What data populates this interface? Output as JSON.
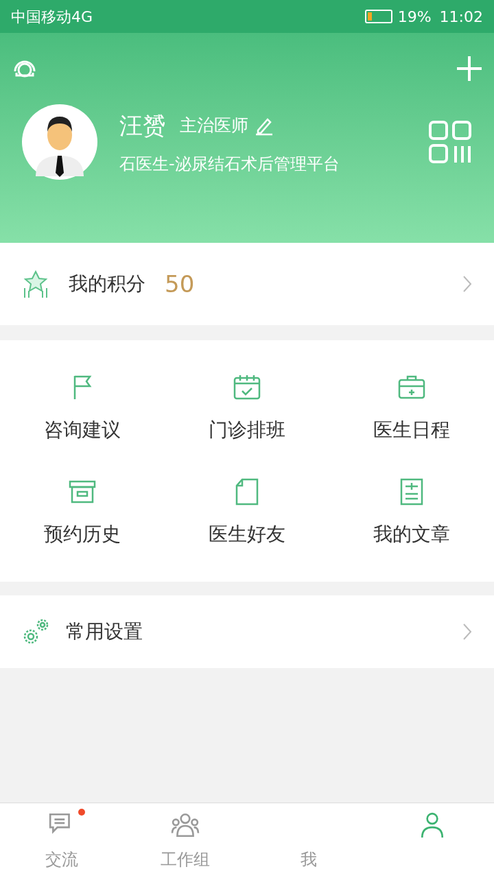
{
  "status_bar": {
    "carrier": "中国移动4G",
    "battery": "19%",
    "time": "11:02"
  },
  "profile": {
    "name": "汪赟",
    "title": "主治医师",
    "platform": "石医生-泌尿结石术后管理平台"
  },
  "points": {
    "label": "我的积分",
    "value": "50"
  },
  "grid": [
    {
      "label": "咨询建议"
    },
    {
      "label": "门诊排班"
    },
    {
      "label": "医生日程"
    },
    {
      "label": "预约历史"
    },
    {
      "label": "医生好友"
    },
    {
      "label": "我的文章"
    }
  ],
  "settings": {
    "label": "常用设置"
  },
  "tab_bar": [
    {
      "label": "交流",
      "badge": true,
      "selected": false
    },
    {
      "label": "工作组",
      "badge": false,
      "selected": false
    },
    {
      "label": "我",
      "badge": false,
      "selected": false
    },
    {
      "badge": false,
      "selected": true
    }
  ]
}
